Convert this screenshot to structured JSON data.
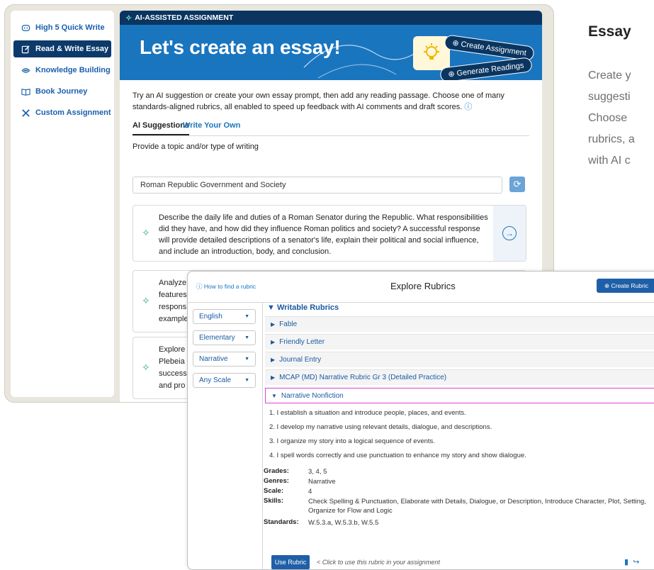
{
  "sidebar": {
    "items": [
      {
        "label": "High 5 Quick Write",
        "icon": "quick-write-icon",
        "active": false
      },
      {
        "label": "Read & Write Essay",
        "icon": "edit-icon",
        "active": true
      },
      {
        "label": "Knowledge Building",
        "icon": "knowledge-icon",
        "active": false
      },
      {
        "label": "Book Journey",
        "icon": "book-icon",
        "active": false
      },
      {
        "label": "Custom Assignment",
        "icon": "tools-icon",
        "active": false
      }
    ]
  },
  "hero": {
    "badge": "AI-ASSISTED ASSIGNMENT",
    "title": "Let's create an essay!",
    "create_assignment": "Create Assignment",
    "generate_readings": "Generate Readings"
  },
  "main": {
    "intro": "Try an AI suggestion or create your own essay prompt, then add any reading passage. Choose one of many standards-aligned rubrics, all enabled to speed up feedback with AI comments and draft scores.",
    "tabs": [
      "AI Suggestions",
      "Write Your Own"
    ],
    "topic_label": "Provide a topic and/or type of writing",
    "topic_value": "Roman Republic Government and Society",
    "suggestions": [
      "Describe the daily life and duties of a Roman Senator during the Republic. What responsibilities did they have, and how did they influence Roman politics and society? A successful response will provide detailed descriptions of a senator's life, explain their political and social influence, and include an introduction, body, and conclusion.",
      "Analyze features respons example",
      "Explore Plebeia success and pro"
    ]
  },
  "side_text": {
    "heading": "Essay",
    "lines": [
      "Create y",
      "suggesti",
      "Choose",
      "rubrics, a",
      "with AI c"
    ]
  },
  "modal": {
    "help_link": "How to find a rubric",
    "title": "Explore Rubrics",
    "create_button": "Create Rubric",
    "filters": [
      "English",
      "Elementary",
      "Narrative",
      "Any Scale"
    ],
    "section": "Writable Rubrics",
    "rubrics": [
      "Fable",
      "Friendly Letter",
      "Journal Entry",
      "MCAP (MD) Narrative Rubric Gr 3 (Detailed Practice)",
      "Narrative Nonfiction"
    ],
    "criteria": [
      "1. I establish a situation and introduce people, places, and events.",
      "2. I develop my narrative using relevant details, dialogue, and descriptions.",
      "3. I organize my story into a logical sequence of events.",
      "4. I spell words correctly and use punctuation to enhance my story and show dialogue."
    ],
    "meta": {
      "grades_label": "Grades:",
      "grades": "3, 4, 5",
      "genres_label": "Genres:",
      "genres": "Narrative",
      "scale_label": "Scale:",
      "scale": "4",
      "skills_label": "Skills:",
      "skills": "Check Spelling & Punctuation, Elaborate with Details, Dialogue, or Description, Introduce Character, Plot, Setting, Organize for Flow and Logic",
      "standards_label": "Standards:",
      "standards": "W.5.3.a, W.5.3.b, W.5.5"
    },
    "use_button": "Use Rubric",
    "use_hint": "< Click to use this rubric in your assignment"
  }
}
